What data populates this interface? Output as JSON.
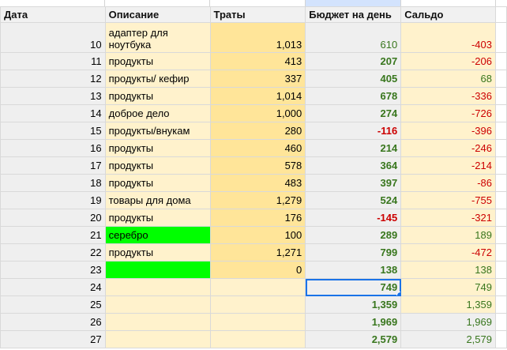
{
  "headers": {
    "date": "Дата",
    "desc": "Описание",
    "spent": "Траты",
    "budget": "Бюджет на день",
    "balance": "Сальдо"
  },
  "rows": [
    {
      "date": "10",
      "desc": "адаптер для ноутбука",
      "spent": "1,013",
      "budget": "610",
      "balance": "-403"
    },
    {
      "date": "11",
      "desc": "продукты",
      "spent": "413",
      "budget": "207",
      "balance": "-206"
    },
    {
      "date": "12",
      "desc": "продукты/ кефир",
      "spent": "337",
      "budget": "405",
      "balance": "68"
    },
    {
      "date": "13",
      "desc": "продукты",
      "spent": "1,014",
      "budget": "678",
      "balance": "-336"
    },
    {
      "date": "14",
      "desc": "доброе дело",
      "spent": "1,000",
      "budget": "274",
      "balance": "-726"
    },
    {
      "date": "15",
      "desc": "продукты/внукам",
      "spent": "280",
      "budget": "-116",
      "balance": "-396"
    },
    {
      "date": "16",
      "desc": "продукты",
      "spent": "460",
      "budget": "214",
      "balance": "-246"
    },
    {
      "date": "17",
      "desc": "продукты",
      "spent": "578",
      "budget": "364",
      "balance": "-214"
    },
    {
      "date": "18",
      "desc": "продукты",
      "spent": "483",
      "budget": "397",
      "balance": "-86"
    },
    {
      "date": "19",
      "desc": "товары для дома",
      "spent": "1,279",
      "budget": "524",
      "balance": "-755"
    },
    {
      "date": "20",
      "desc": "продукты",
      "spent": "176",
      "budget": "-145",
      "balance": "-321"
    },
    {
      "date": "21",
      "desc": "серебро",
      "spent": "100",
      "budget": "289",
      "balance": "189"
    },
    {
      "date": "22",
      "desc": "продукты",
      "spent": "1,271",
      "budget": "799",
      "balance": "-472"
    },
    {
      "date": "23",
      "desc": "",
      "spent": "0",
      "budget": "138",
      "balance": "138"
    },
    {
      "date": "24",
      "desc": "",
      "spent": "",
      "budget": "749",
      "balance": "749"
    },
    {
      "date": "25",
      "desc": "",
      "spent": "",
      "budget": "1,359",
      "balance": "1,359"
    },
    {
      "date": "26",
      "desc": "",
      "spent": "",
      "budget": "1,969",
      "balance": "1,969"
    },
    {
      "date": "27",
      "desc": "",
      "spent": "",
      "budget": "2,579",
      "balance": "2,579"
    }
  ],
  "colors": {
    "positive": "#38761d",
    "negative": "#cc0000",
    "highlight": "#00ff00"
  }
}
